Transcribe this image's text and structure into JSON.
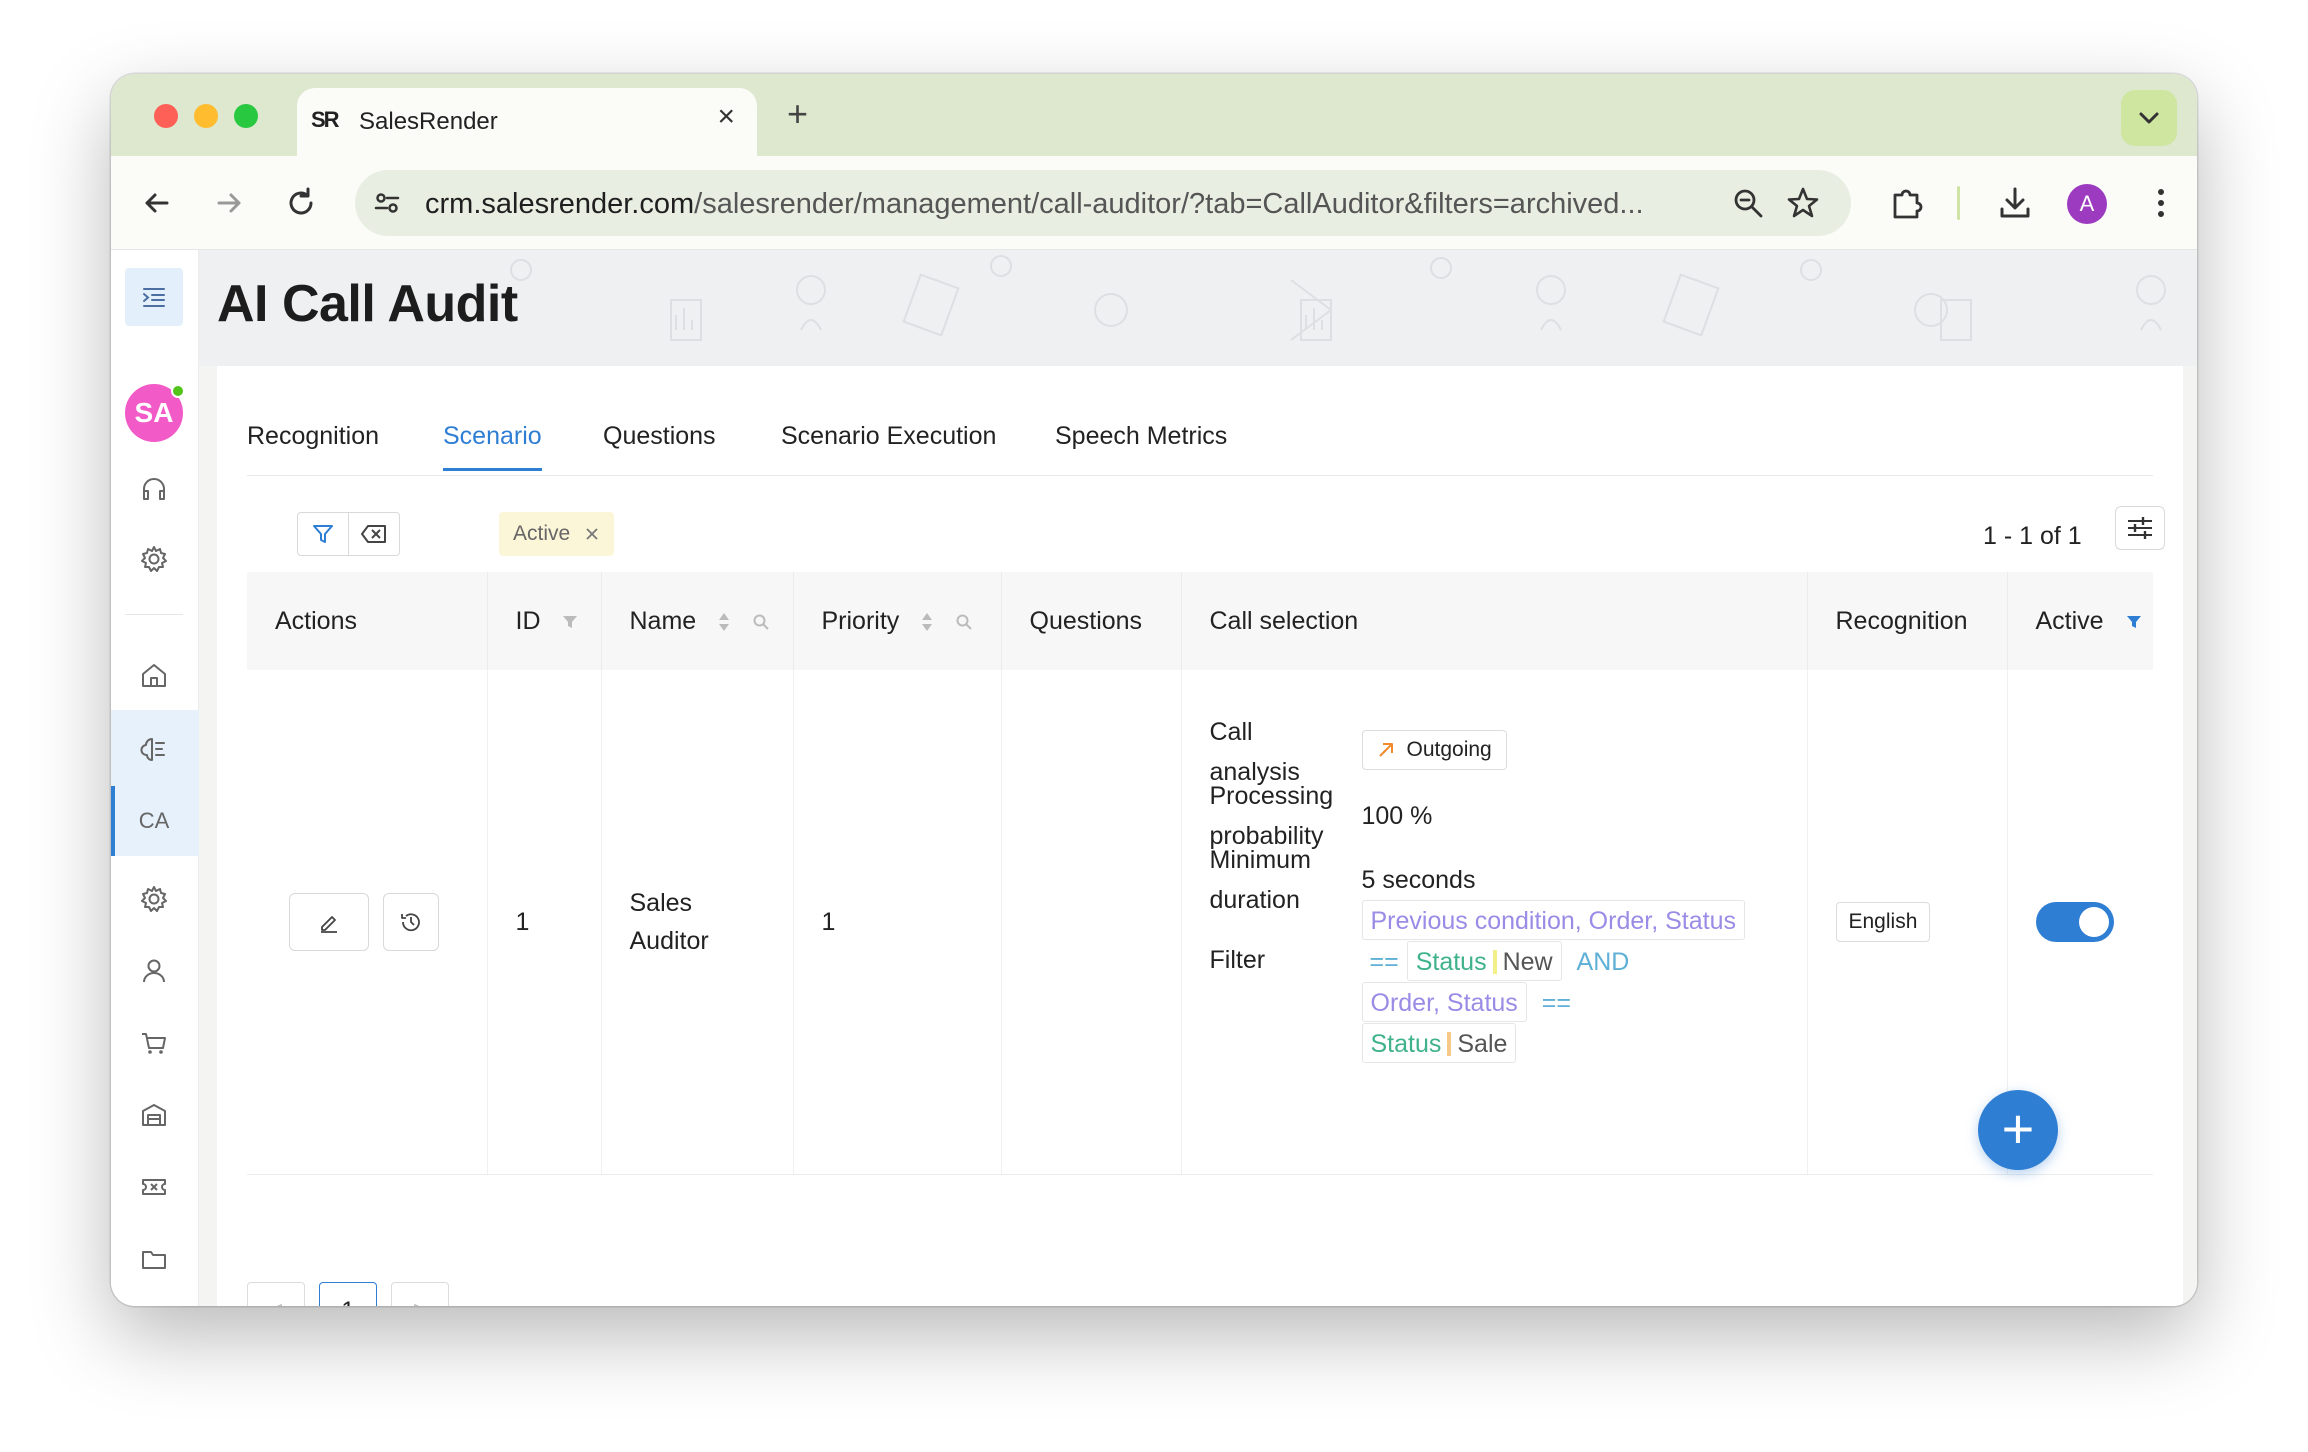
{
  "browser": {
    "tab_title": "SalesRender",
    "favicon_text": "SR",
    "new_tab_label": "+",
    "url_host": "crm.salesrender.com",
    "url_path": "/salesrender/management/call-auditor/?tab=CallAuditor&filters=archived...",
    "profile_initial": "A"
  },
  "sidebar": {
    "user_initials": "SA",
    "current_section": "CA"
  },
  "page": {
    "title": "AI Call Audit",
    "tabs": [
      "Recognition",
      "Scenario",
      "Questions",
      "Scenario Execution",
      "Speech Metrics"
    ],
    "active_tab": "Scenario"
  },
  "filters": {
    "active_chip": "Active",
    "count_label": "1 - 1 of 1"
  },
  "table": {
    "columns": [
      "Actions",
      "ID",
      "Name",
      "Priority",
      "Questions",
      "Call selection",
      "Recognition",
      "Active"
    ],
    "rows": [
      {
        "id": "1",
        "name": "Sales Auditor",
        "priority": "1",
        "questions": "",
        "call_selection": {
          "call_analysis_label": "Call analysis",
          "call_analysis_value": "Outgoing",
          "processing_probability_label": "Processing probability",
          "processing_probability_value": "100 %",
          "minimum_duration_label": "Minimum duration",
          "minimum_duration_value": "5 seconds",
          "filter_label": "Filter",
          "filter": {
            "path1": "Previous condition, Order, Status",
            "op1": "==",
            "field1": "Status",
            "value1": "New",
            "conj": "AND",
            "path2": "Order, Status",
            "op2": "==",
            "field2": "Status",
            "value2": "Sale"
          }
        },
        "recognition": "English",
        "active": true
      }
    ]
  },
  "pagination": {
    "current_page": "1",
    "prev": "<",
    "next": ">"
  },
  "colors": {
    "accent": "#2e7ed4",
    "value_new_bar": "#f3f08a",
    "value_sale_bar": "#f6c98b",
    "outgoing_arrow": "#f08a2a"
  }
}
